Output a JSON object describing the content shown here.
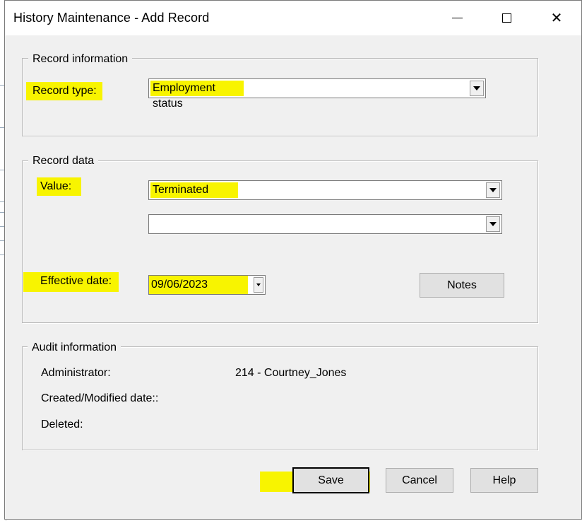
{
  "window": {
    "title": "History Maintenance - Add Record",
    "controls": {
      "minimize": "minimize",
      "maximize": "maximize",
      "close": "✕"
    }
  },
  "record_information": {
    "legend": "Record information",
    "record_type_label": "Record type:",
    "record_type_value": "Employment status"
  },
  "record_data": {
    "legend": "Record data",
    "value_label": "Value:",
    "value_primary": "Terminated",
    "value_secondary": "",
    "effective_date_label": "Effective date:",
    "effective_date_value": "09/06/2023",
    "notes_button": "Notes"
  },
  "audit_information": {
    "legend": "Audit information",
    "administrator_label": "Administrator:",
    "administrator_value": "214 - Courtney_Jones",
    "created_modified_label": "Created/Modified date::",
    "created_modified_value": "",
    "deleted_label": "Deleted:",
    "deleted_value": ""
  },
  "buttons": {
    "save": "Save",
    "cancel": "Cancel",
    "help": "Help"
  },
  "colors": {
    "highlight": "#f8f400",
    "dialog_bg": "#f0f0f0",
    "button_bg": "#e1e1e1"
  }
}
